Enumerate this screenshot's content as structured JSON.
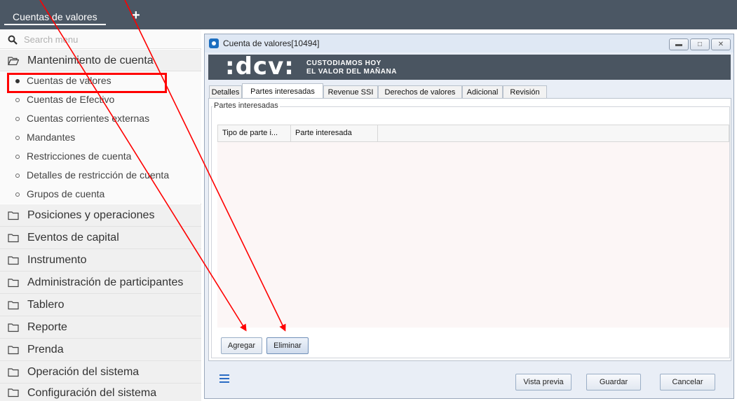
{
  "top_tab": {
    "label": "Cuentas de valores",
    "add_icon": "plus-icon"
  },
  "menu": {
    "search_placeholder": "Search menu",
    "sections": [
      {
        "label": "Mantenimiento de cuenta",
        "expanded": true
      },
      {
        "label": "Posiciones y operaciones"
      },
      {
        "label": "Eventos de capital"
      },
      {
        "label": "Instrumento"
      },
      {
        "label": "Administración de participantes"
      },
      {
        "label": "Tablero"
      },
      {
        "label": "Reporte"
      },
      {
        "label": "Prenda"
      },
      {
        "label": "Operación del sistema"
      },
      {
        "label": "Configuración del sistema"
      }
    ],
    "subitems": [
      {
        "label": "Cuentas de valores",
        "selected": true
      },
      {
        "label": "Cuentas de Efectivo"
      },
      {
        "label": "Cuentas corrientes externas"
      },
      {
        "label": "Mandantes"
      },
      {
        "label": "Restricciones de cuenta"
      },
      {
        "label": "Detalles de restricción de cuenta"
      },
      {
        "label": "Grupos de cuenta"
      }
    ]
  },
  "window": {
    "title": "Cuenta de valores[10494]",
    "banner": {
      "logo": ":dcv:",
      "tagline_line1": "CUSTODIAMOS HOY",
      "tagline_line2": "EL VALOR DEL MAÑANA"
    },
    "tabs": [
      "Detalles",
      "Partes interesadas",
      "Revenue SSI",
      "Derechos de valores",
      "Adicional",
      "Revisión"
    ],
    "active_tab": "Partes interesadas",
    "group_label": "Partes interesadas",
    "grid_columns": [
      "Tipo de parte i...",
      "Parte interesada"
    ],
    "add_button": "Agregar",
    "delete_button": "Eliminar",
    "footer_buttons": {
      "preview": "Vista previa",
      "save": "Guardar",
      "cancel": "Cancelar"
    }
  },
  "colors": {
    "topbar": "#4b5764",
    "accent": "#2b6cc4",
    "annotation_red": "#ff0000"
  }
}
